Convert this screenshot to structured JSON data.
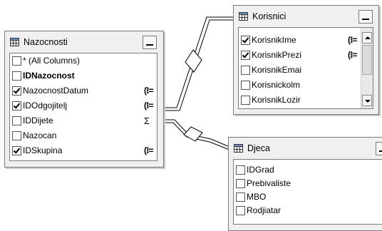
{
  "tables": {
    "nazocnosti": {
      "title": "Nazocnosti",
      "columns": [
        {
          "label": "* (All Columns)",
          "checked": false,
          "bold": false,
          "type_glyph": ""
        },
        {
          "label": "IDNazocnost",
          "checked": false,
          "bold": true,
          "type_glyph": ""
        },
        {
          "label": "NazocnostDatum",
          "checked": true,
          "bold": false,
          "type_glyph": "(⁝="
        },
        {
          "label": "IDOdgojitelj",
          "checked": true,
          "bold": false,
          "type_glyph": "(⁝="
        },
        {
          "label": "IDDijete",
          "checked": false,
          "bold": false,
          "type_glyph": "Σ"
        },
        {
          "label": "Nazocan",
          "checked": false,
          "bold": false,
          "type_glyph": ""
        },
        {
          "label": "IDSkupina",
          "checked": true,
          "bold": false,
          "type_glyph": "(⁝="
        }
      ]
    },
    "korisnici": {
      "title": "Korisnici",
      "columns": [
        {
          "label": "KorisnikIme",
          "checked": true,
          "type_glyph": "(⁝="
        },
        {
          "label": "KorisnikPrezi",
          "checked": true,
          "type_glyph": "(⁝="
        },
        {
          "label": "KorisnikEmai",
          "checked": false,
          "type_glyph": ""
        },
        {
          "label": "Korisnickolm",
          "checked": false,
          "type_glyph": ""
        },
        {
          "label": "KorisnikLozir",
          "checked": false,
          "type_glyph": ""
        }
      ]
    },
    "djeca": {
      "title": "Djeca",
      "columns": [
        {
          "label": "IDGrad",
          "checked": false
        },
        {
          "label": "Prebivaliste",
          "checked": false
        },
        {
          "label": "MBO",
          "checked": false
        },
        {
          "label": "Rodjiatar",
          "checked": false
        }
      ]
    }
  }
}
